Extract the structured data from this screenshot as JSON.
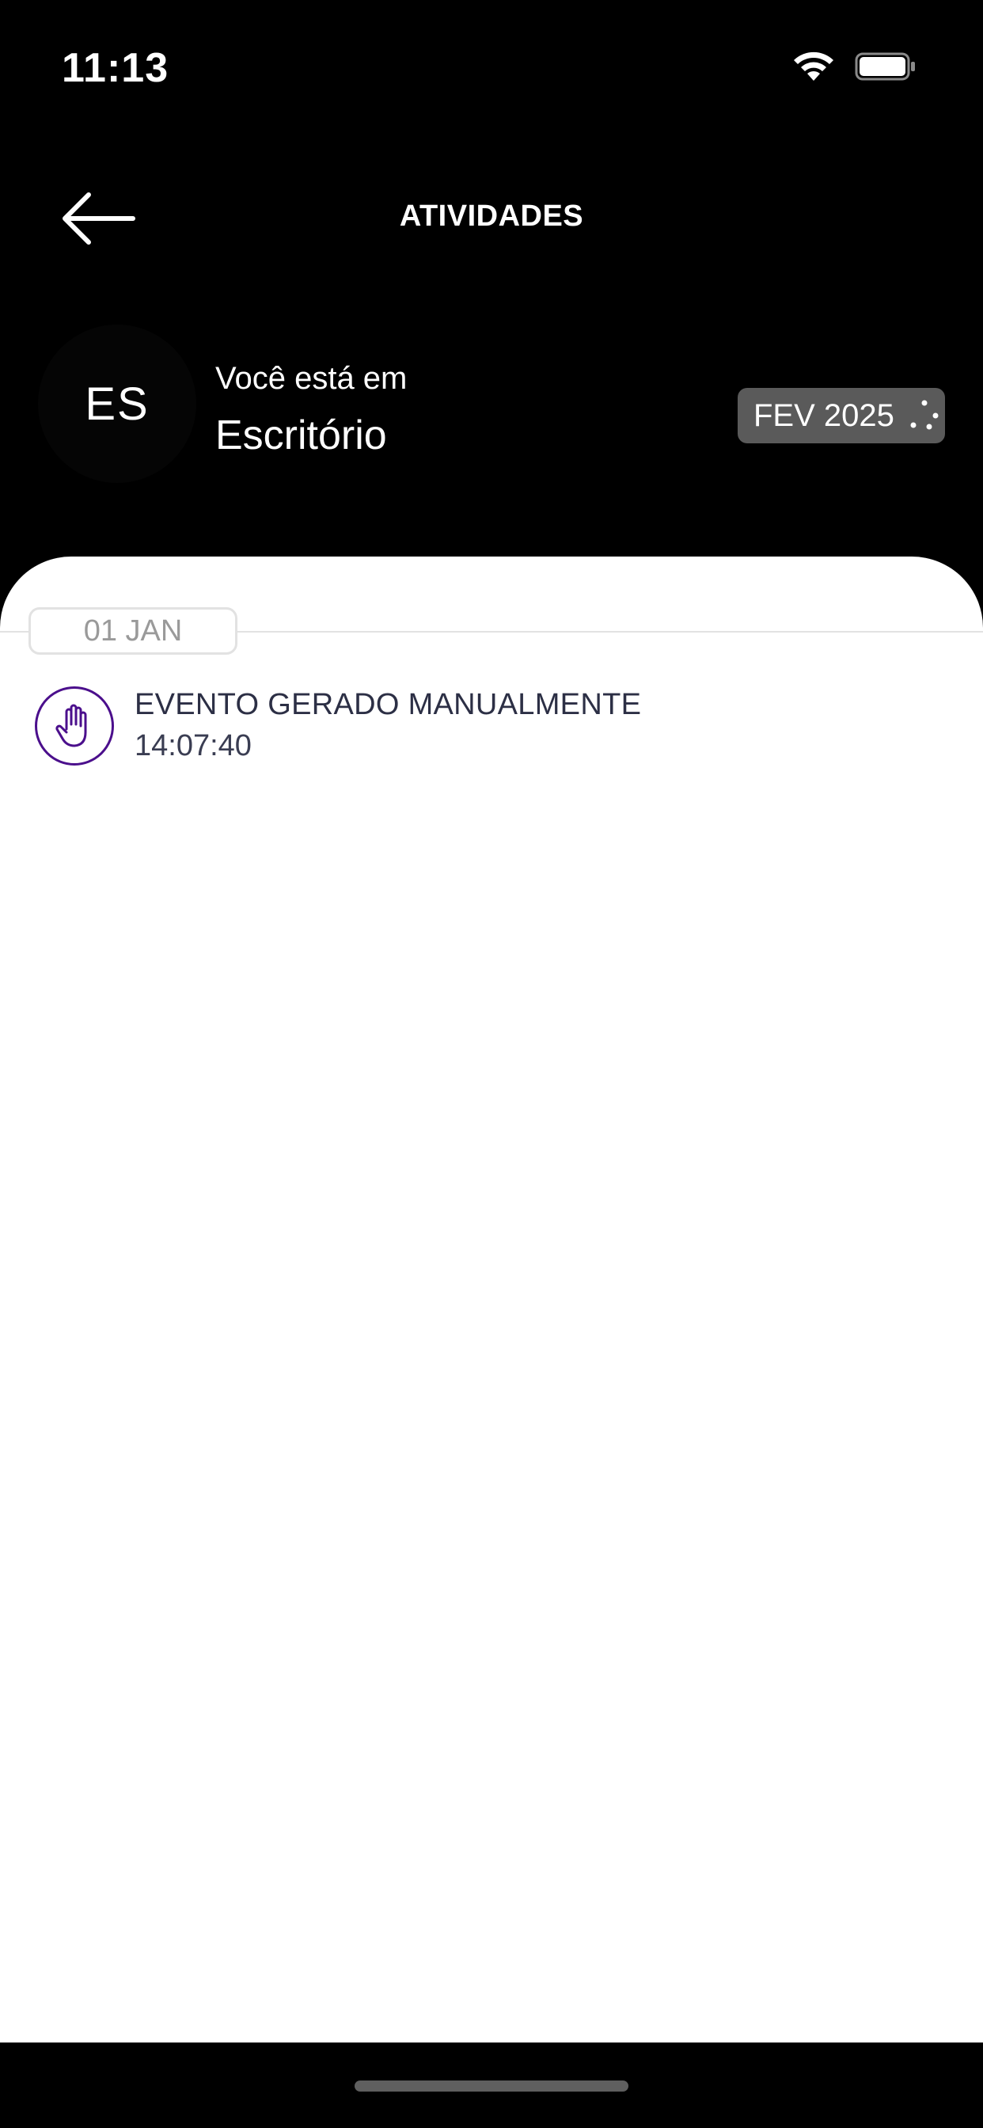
{
  "status_bar": {
    "time": "11:13",
    "icons": [
      "wifi-icon",
      "battery-icon"
    ]
  },
  "header": {
    "back_icon": "arrow-left-icon",
    "title": "ATIVIDADES"
  },
  "location": {
    "avatar_initials": "ES",
    "caption": "Você está em",
    "name": "Escritório"
  },
  "period_selector": {
    "label": "FEV 2025",
    "icon": "loading-dots-icon"
  },
  "activity_groups": [
    {
      "date": "01 JAN",
      "events": [
        {
          "icon": "hand-icon",
          "title": "EVENTO GERADO MANUALMENTE",
          "time": "14:07:40"
        }
      ]
    }
  ],
  "colors": {
    "background": "#000000",
    "sheet": "#ffffff",
    "accent_purple": "#4b0f8c",
    "pill": "#5a5a5a"
  }
}
